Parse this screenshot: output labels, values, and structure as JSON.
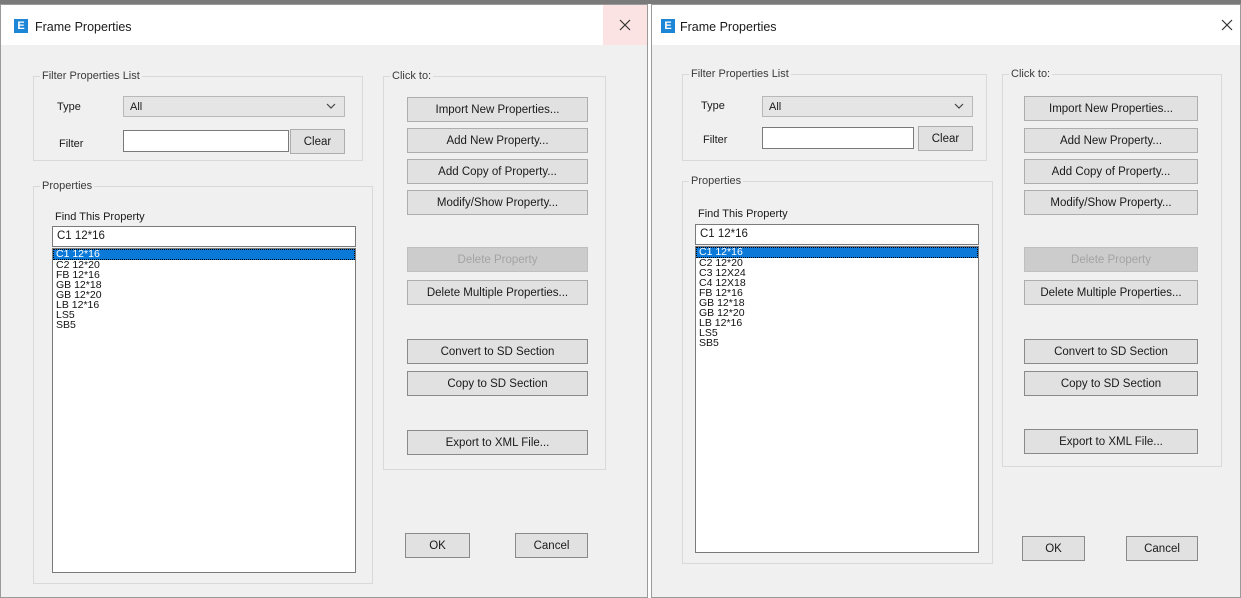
{
  "dialogs": [
    {
      "title": "Frame Properties",
      "app_icon": "E",
      "close_icon": "close-icon",
      "filter_group": {
        "legend": "Filter Properties List",
        "type_label": "Type",
        "type_value": "All",
        "filter_label": "Filter",
        "filter_value": "",
        "clear_label": "Clear"
      },
      "properties_group": {
        "legend": "Properties",
        "find_label": "Find This Property",
        "find_value": "C1 12*16",
        "items": [
          "C1 12*16",
          "C2 12*20",
          "FB 12*16",
          "GB 12*18",
          "GB 12*20",
          "LB 12*16",
          "LS5",
          "SB5"
        ],
        "selected_index": 0
      },
      "click_group": {
        "legend": "Click to:",
        "buttons": {
          "import": "Import New Properties...",
          "add_new": "Add New Property...",
          "add_copy": "Add Copy of Property...",
          "modify": "Modify/Show Property...",
          "delete": "Delete Property",
          "delete_multiple": "Delete Multiple Properties...",
          "convert_sd": "Convert to SD Section",
          "copy_sd": "Copy to SD Section",
          "export_xml": "Export to XML File..."
        }
      },
      "ok_label": "OK",
      "cancel_label": "Cancel"
    },
    {
      "title": "Frame Properties",
      "app_icon": "E",
      "close_icon": "close-icon",
      "filter_group": {
        "legend": "Filter Properties List",
        "type_label": "Type",
        "type_value": "All",
        "filter_label": "Filter",
        "filter_value": "",
        "clear_label": "Clear"
      },
      "properties_group": {
        "legend": "Properties",
        "find_label": "Find This Property",
        "find_value": "C1 12*16",
        "items": [
          "C1 12*16",
          "C2 12*20",
          "C3 12X24",
          "C4 12X18",
          "FB 12*16",
          "GB 12*18",
          "GB 12*20",
          "LB 12*16",
          "LS5",
          "SB5"
        ],
        "selected_index": 0
      },
      "click_group": {
        "legend": "Click to:",
        "buttons": {
          "import": "Import New Properties...",
          "add_new": "Add New Property...",
          "add_copy": "Add Copy of Property...",
          "modify": "Modify/Show Property...",
          "delete": "Delete Property",
          "delete_multiple": "Delete Multiple Properties...",
          "convert_sd": "Convert to SD Section",
          "copy_sd": "Copy to SD Section",
          "export_xml": "Export to XML File..."
        }
      },
      "ok_label": "OK",
      "cancel_label": "Cancel"
    }
  ],
  "colors": {
    "dialog_bg": "#f0f0f0",
    "titlebar_bg": "#ffffff",
    "app_icon": "#1e86d6",
    "selection": "#0b79d8",
    "close_hover": "#fbe3e3"
  }
}
